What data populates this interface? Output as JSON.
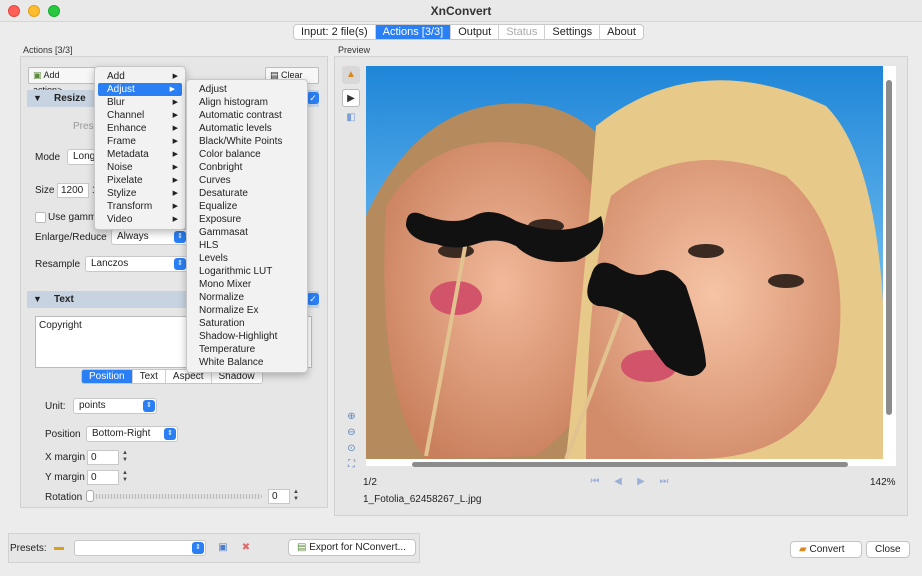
{
  "window": {
    "title": "XnConvert"
  },
  "tabs": [
    {
      "label": "Input: 2 file(s)",
      "state": "normal"
    },
    {
      "label": "Actions [3/3]",
      "state": "active"
    },
    {
      "label": "Output",
      "state": "normal"
    },
    {
      "label": "Status",
      "state": "disabled"
    },
    {
      "label": "Settings",
      "state": "normal"
    },
    {
      "label": "About",
      "state": "normal"
    }
  ],
  "actions_panel": {
    "title": "Actions [3/3]",
    "add_action_label": "Add action>",
    "clear_all_label": "Clear all"
  },
  "resize": {
    "header": "Resize",
    "preset_label": "Prese",
    "mode_label": "Mode",
    "mode_value": "Longe",
    "size_label": "Size",
    "size_value": "1200",
    "size_value2": "1",
    "use_gamma_label": "Use gamm",
    "enlarge_label": "Enlarge/Reduce",
    "enlarge_value": "Always",
    "resample_label": "Resample",
    "resample_value": "Lanczos"
  },
  "text_action": {
    "header": "Text",
    "text_value": "Copyright",
    "subtabs": [
      "Position",
      "Text",
      "Aspect",
      "Shadow"
    ],
    "unit_label": "Unit:",
    "unit_value": "points",
    "position_label": "Position",
    "position_value": "Bottom-Right",
    "xmargin_label": "X margin",
    "xmargin_value": "0",
    "ymargin_label": "Y margin",
    "ymargin_value": "0",
    "rotation_label": "Rotation",
    "rotation_value": "0"
  },
  "add_menu": {
    "items": [
      "Add",
      "Adjust",
      "Blur",
      "Channel",
      "Enhance",
      "Frame",
      "Metadata",
      "Noise",
      "Pixelate",
      "Stylize",
      "Transform",
      "Video"
    ],
    "highlighted": "Adjust"
  },
  "adjust_submenu": {
    "items": [
      "Adjust",
      "Align histogram",
      "Automatic contrast",
      "Automatic levels",
      "Black/White Points",
      "Color balance",
      "Conbright",
      "Curves",
      "Desaturate",
      "Equalize",
      "Exposure",
      "Gammasat",
      "HLS",
      "Levels",
      "Logarithmic LUT",
      "Mono Mixer",
      "Normalize",
      "Normalize Ex",
      "Saturation",
      "Shadow-Highlight",
      "Temperature",
      "White Balance"
    ]
  },
  "preview": {
    "title": "Preview",
    "page_indicator": "1/2",
    "zoom_level": "142%",
    "filename": "1_Fotolia_62458267_L.jpg"
  },
  "bottom": {
    "presets_label": "Presets:",
    "export_label": "Export for NConvert...",
    "convert_label": "Convert",
    "close_label": "Close"
  },
  "colors": {
    "accent": "#2a7ff5",
    "group_header": "#c7d3e0"
  }
}
